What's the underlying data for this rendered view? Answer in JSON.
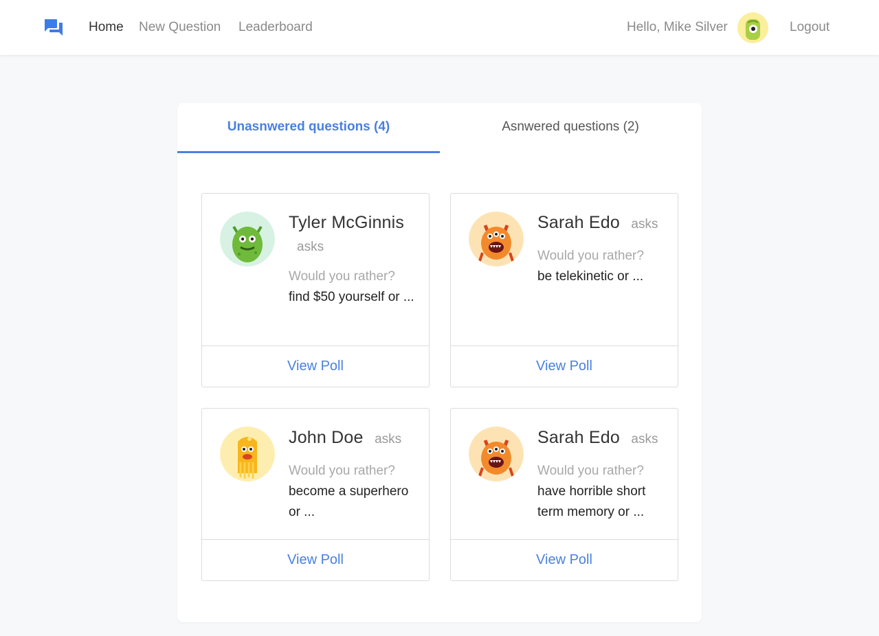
{
  "nav": {
    "logo_icon": "chat-bubbles-icon",
    "links": [
      "Home",
      "New Question",
      "Leaderboard"
    ],
    "greeting": "Hello, Mike Silver",
    "logout": "Logout",
    "accent": "#4a7fe0"
  },
  "tabs": {
    "unanswered": "Unasnwered questions (4)",
    "answered": "Asnwered questions (2)"
  },
  "polls": [
    {
      "author": "Tyler McGinnis",
      "asks": "asks",
      "prompt": "Would you rather?",
      "preview": "find $50 yourself or ...",
      "action": "View Poll",
      "avatar": "green-monster-avatar"
    },
    {
      "author": "Sarah Edo",
      "asks": "asks",
      "prompt": "Would you rather?",
      "preview": "be telekinetic or ...",
      "action": "View Poll",
      "avatar": "orange-monster-avatar"
    },
    {
      "author": "John Doe",
      "asks": "asks",
      "prompt": "Would you rather?",
      "preview": "become a superhero or ...",
      "action": "View Poll",
      "avatar": "yellow-monster-avatar"
    },
    {
      "author": "Sarah Edo",
      "asks": "asks",
      "prompt": "Would you rather?",
      "preview": "have horrible short term memory or ...",
      "action": "View Poll",
      "avatar": "orange-monster-avatar"
    }
  ]
}
